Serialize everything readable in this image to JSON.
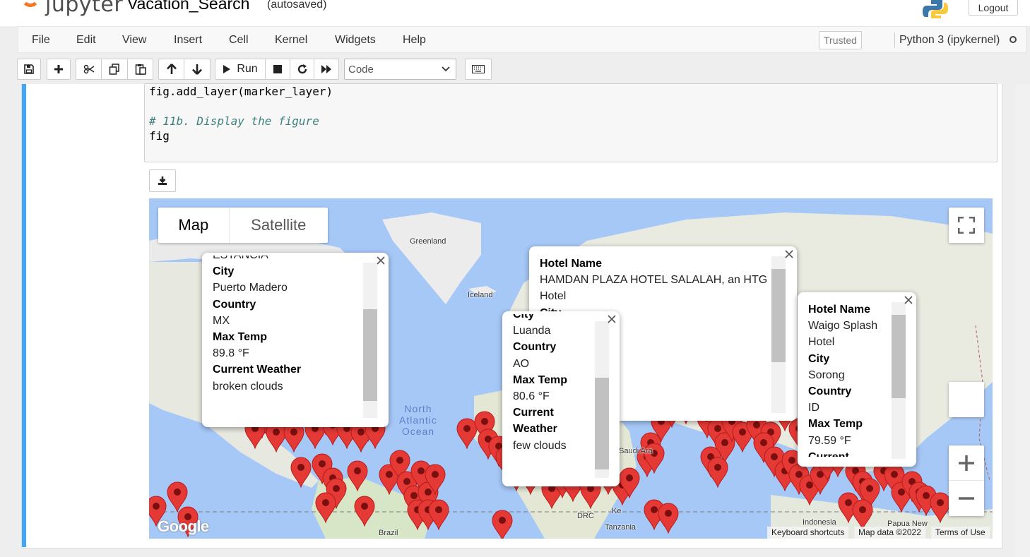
{
  "header": {
    "logo_text": "jupyter",
    "notebook_name": "Vacation_Search",
    "autosave_status": "(autosaved)",
    "logout_label": "Logout"
  },
  "menubar": {
    "items": [
      "File",
      "Edit",
      "View",
      "Insert",
      "Cell",
      "Kernel",
      "Widgets",
      "Help"
    ],
    "trusted_label": "Trusted",
    "kernel_name": "Python 3 (ipykernel)"
  },
  "toolbar": {
    "run_label": "Run",
    "cell_type": "Code"
  },
  "cell": {
    "lines": [
      {
        "text": "fig.add_layer(marker_layer)",
        "kind": "code"
      },
      {
        "text": "",
        "kind": "code"
      },
      {
        "text": "# 11b. Display the figure",
        "kind": "comment"
      },
      {
        "text": "fig",
        "kind": "code"
      }
    ]
  },
  "map": {
    "map_type_selected": "Map",
    "map_type_other": "Satellite",
    "marker_color": "#e53935",
    "labels": {
      "greenland": "Greenland",
      "iceland": "Iceland",
      "ocean_line1": "North",
      "ocean_line2": "Atlantic",
      "ocean_line3": "Ocean",
      "saudi": "Saudi Ara",
      "brazil": "Brazil",
      "tanzania": "Tanzania",
      "drc": "DRC",
      "ke": "Ke",
      "indonesia": "Indonesia",
      "papua": "Papua New"
    },
    "attribution": {
      "google": "Google",
      "shortcuts": "Keyboard shortcuts",
      "map_data": "Map data ©2022",
      "terms": "Terms of Use"
    },
    "infowindows": {
      "w1": {
        "cut_top": "ESTANCIA",
        "city_label": "City",
        "city": "Puerto Madero",
        "country_label": "Country",
        "country": "MX",
        "temp_label": "Max Temp",
        "temp": "89.8 °F",
        "weather_label": "Current Weather",
        "weather": "broken clouds"
      },
      "w2": {
        "hotel_label": "Hotel Name",
        "hotel_line1": "HAMDAN PLAZA HOTEL SALALAH, an HTG",
        "hotel_line2": "Hotel",
        "cut_city": "City"
      },
      "w3": {
        "cut_top": "City",
        "city": "Luanda",
        "country_label": "Country",
        "country": "AO",
        "temp_label": "Max Temp",
        "temp": "80.6 °F",
        "weather_label1": "Current",
        "weather_label2": "Weather",
        "weather": "few clouds"
      },
      "w4": {
        "hotel_label": "Hotel Name",
        "hotel_line1": "Waigo Splash",
        "hotel_line2": "Hotel",
        "city_label": "City",
        "city": "Sorong",
        "country_label": "Country",
        "country": "ID",
        "temp_label": "Max Temp",
        "temp": "79.59 °F",
        "cut_bottom": "Current"
      }
    }
  }
}
